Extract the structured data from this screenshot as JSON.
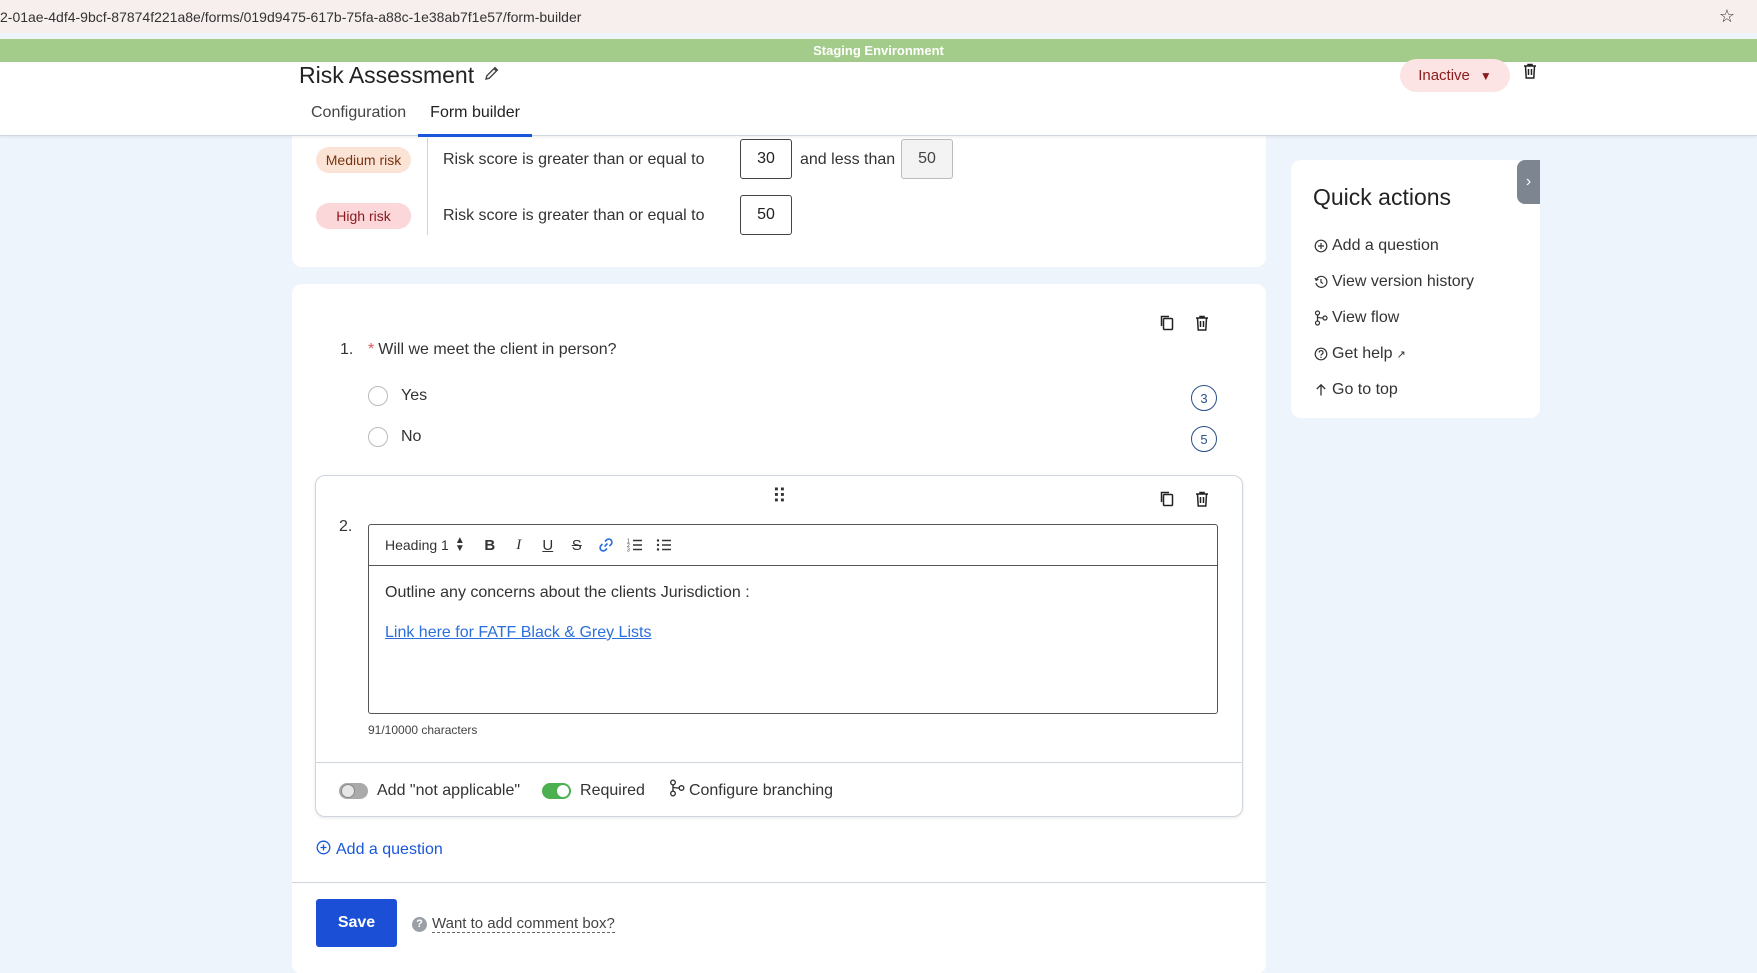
{
  "browser": {
    "url": "2-01ae-4df4-9bcf-87874f221a8e/forms/019d9475-617b-75fa-a88c-1e38ab7f1e57/form-builder"
  },
  "banner": {
    "text": "Staging Environment"
  },
  "header": {
    "title": "Risk Assessment",
    "tabs": [
      {
        "label": "Configuration"
      },
      {
        "label": "Form builder"
      }
    ],
    "status": "Inactive"
  },
  "risk": {
    "rows": [
      {
        "badge": "Medium risk",
        "text": "Risk score is greater than or equal to",
        "min": "30",
        "and_label": "and less than",
        "max": "50"
      },
      {
        "badge": "High risk",
        "text": "Risk score is greater than or equal to",
        "min": "50"
      }
    ]
  },
  "question1": {
    "number": "1.",
    "required_mark": "*",
    "label": "Will we meet the client in person?",
    "options": [
      {
        "label": "Yes",
        "score": "3"
      },
      {
        "label": "No",
        "score": "5"
      }
    ]
  },
  "question2": {
    "number": "2.",
    "toolbar": {
      "heading_select": "Heading 1"
    },
    "body_text": "Outline any concerns about the clients Jurisdiction :",
    "link_text": "Link here for FATF Black & Grey Lists",
    "char_count": "91/10000 characters",
    "footer": {
      "not_applicable_label": "Add \"not applicable\"",
      "required_label": "Required",
      "branching_label": "Configure branching"
    }
  },
  "actions": {
    "add_question": "Add a question",
    "save": "Save",
    "comment_hint": "Want to add comment box?"
  },
  "quick_actions": {
    "title": "Quick actions",
    "items": [
      {
        "label": "Add a question",
        "icon": "plus-circle-icon"
      },
      {
        "label": "View version history",
        "icon": "history-icon"
      },
      {
        "label": "View flow",
        "icon": "flow-icon"
      },
      {
        "label": "Get help",
        "icon": "help-icon"
      },
      {
        "label": "Go to top",
        "icon": "arrow-up-icon"
      }
    ]
  },
  "colors": {
    "accent": "#1a56db",
    "banner": "#a3cb8a",
    "status_bg": "#fde4e4",
    "toggle_on": "#4caf50"
  }
}
